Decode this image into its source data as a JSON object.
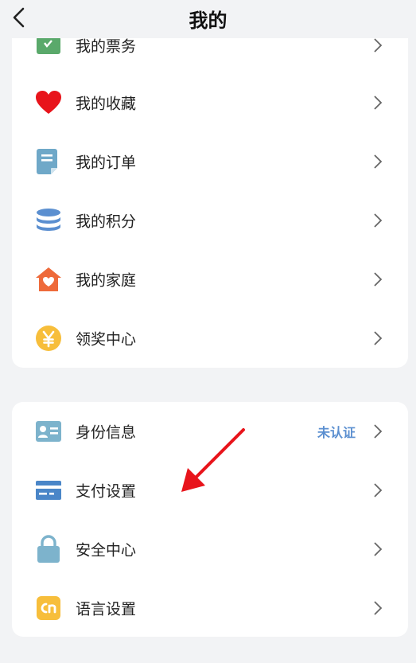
{
  "header": {
    "title": "我的"
  },
  "section1": {
    "items": [
      {
        "label": "我的票务",
        "icon": "ticket-icon"
      },
      {
        "label": "我的收藏",
        "icon": "heart-icon"
      },
      {
        "label": "我的订单",
        "icon": "order-document-icon"
      },
      {
        "label": "我的积分",
        "icon": "coin-stack-icon"
      },
      {
        "label": "我的家庭",
        "icon": "home-heart-icon"
      },
      {
        "label": "领奖中心",
        "icon": "yen-coin-icon"
      }
    ]
  },
  "section2": {
    "items": [
      {
        "label": "身份信息",
        "icon": "id-card-icon",
        "status": "未认证"
      },
      {
        "label": "支付设置",
        "icon": "credit-card-icon"
      },
      {
        "label": "安全中心",
        "icon": "lock-icon"
      },
      {
        "label": "语言设置",
        "icon": "language-cn-icon"
      }
    ]
  },
  "colors": {
    "background": "#f2f3f5",
    "card": "#ffffff",
    "status_text": "#5b8fd0",
    "annotation_arrow": "#e8141b"
  }
}
